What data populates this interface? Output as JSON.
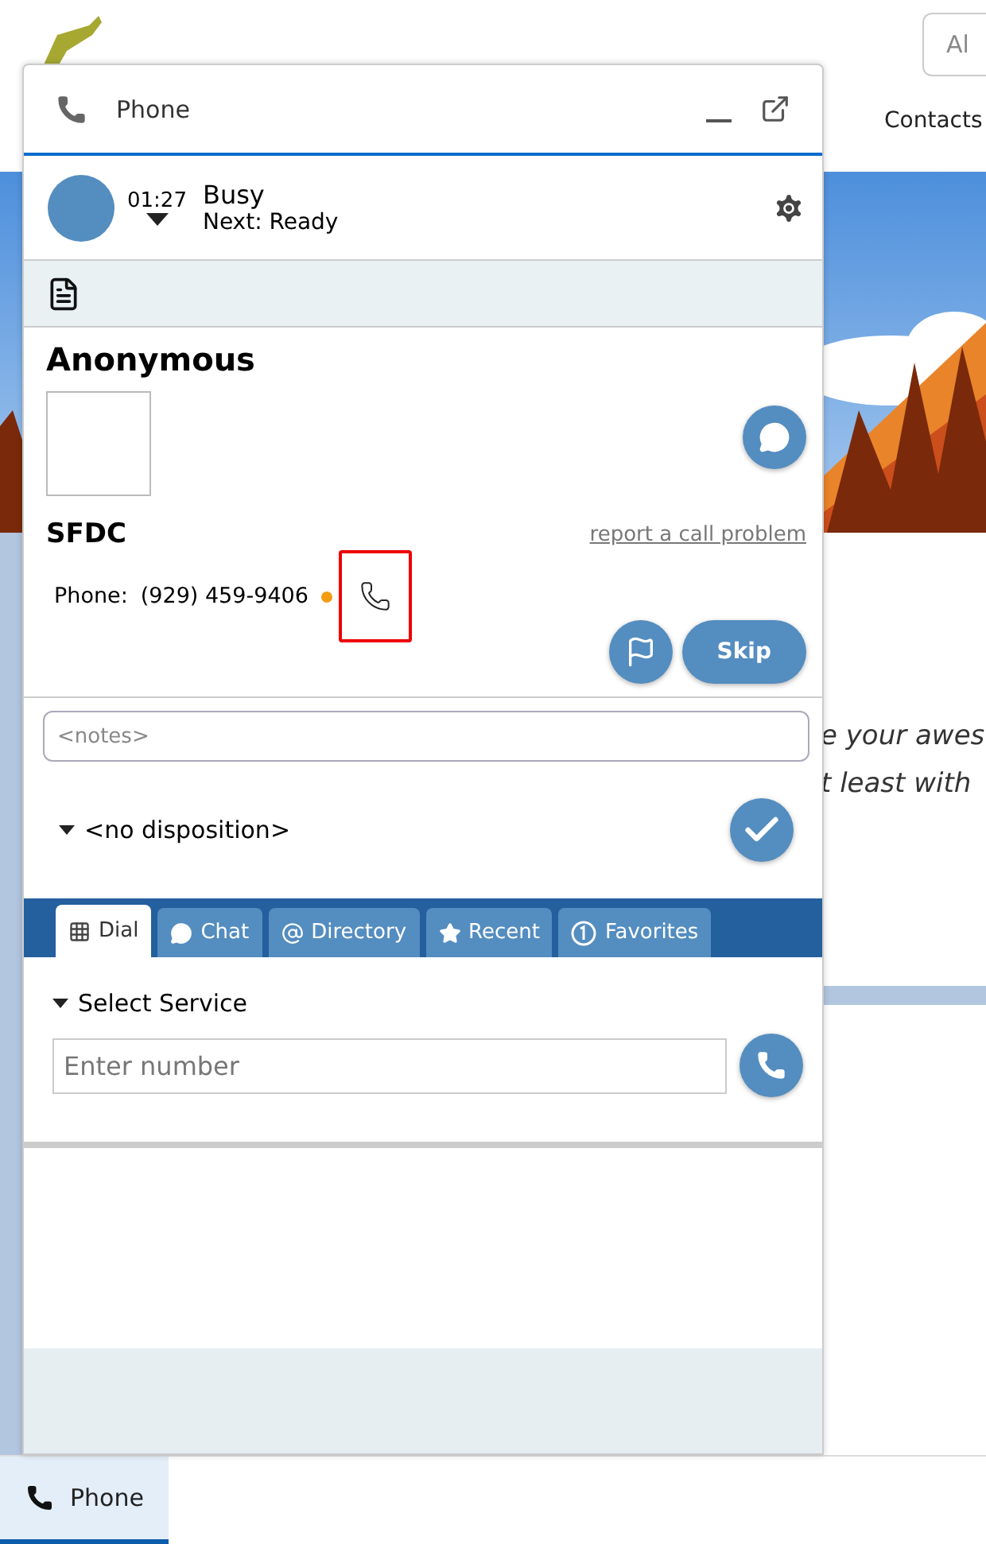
{
  "header": {
    "search": {
      "value": "Al"
    },
    "nav": [
      "Contacts"
    ]
  },
  "banner_text": [
    "e your awes",
    "t least with"
  ],
  "phone_panel": {
    "title": "Phone",
    "agent": {
      "timer": "01:27",
      "status": "Busy",
      "next": "Next: Ready"
    },
    "contact": {
      "name": "Anonymous",
      "source": "SFDC",
      "report_link": "report a call problem",
      "phone_label": "Phone:",
      "phone_number": "(929) 459-9406",
      "call_highlighted": true
    },
    "skip_button": "Skip",
    "notes": {
      "placeholder": "<notes>"
    },
    "disposition": "<no disposition>",
    "tabs": [
      {
        "label": "Dial",
        "kind": "dial",
        "selected": true
      },
      {
        "label": "Chat",
        "kind": "chat",
        "selected": false
      },
      {
        "label": "Directory",
        "kind": "directory",
        "selected": false
      },
      {
        "label": "Recent",
        "kind": "recent",
        "selected": false
      },
      {
        "label": "Favorites",
        "kind": "favorites",
        "selected": false
      }
    ],
    "service": "Select Service",
    "number_field": {
      "placeholder": "Enter number"
    }
  },
  "taskbar": {
    "label": "Phone",
    "selected": true
  }
}
